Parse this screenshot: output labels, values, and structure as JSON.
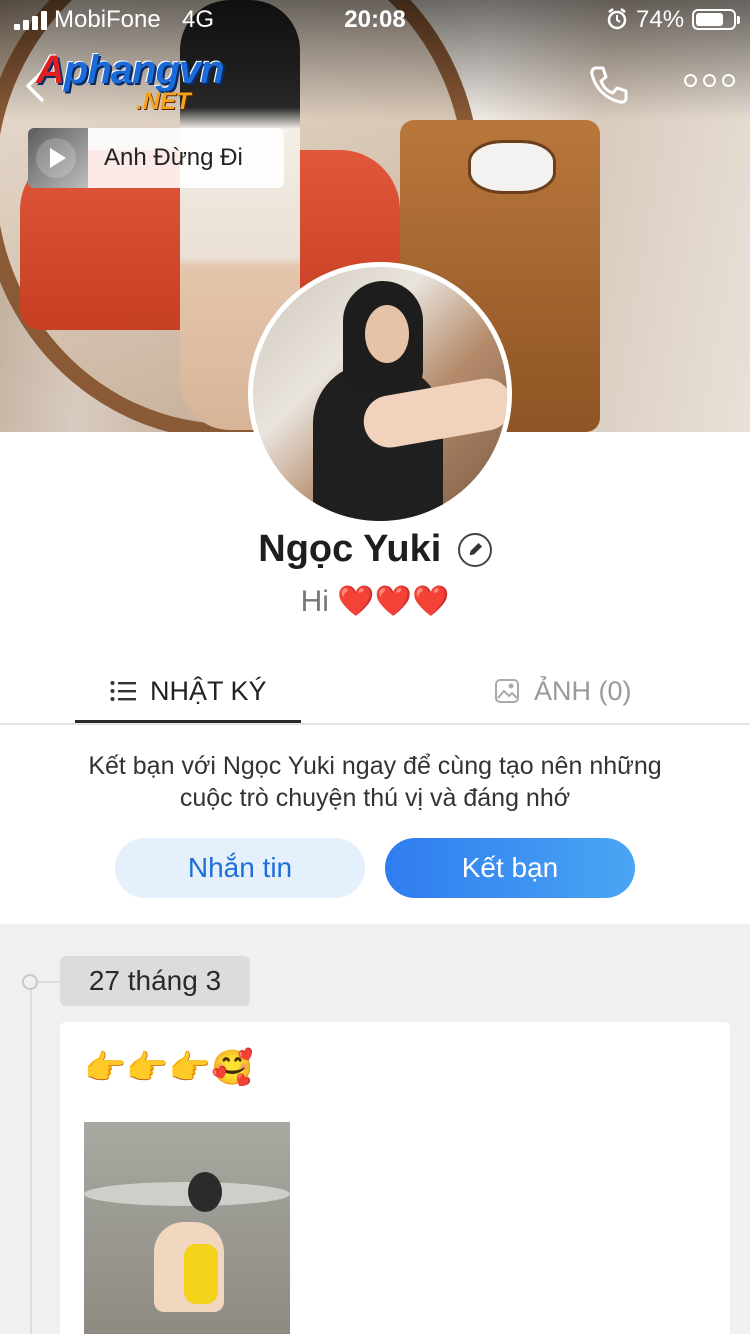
{
  "status_bar": {
    "carrier": "MobiFone",
    "network": "4G",
    "time": "20:08",
    "battery_percent": "74%",
    "battery_level": 0.74
  },
  "nav": {
    "logo_main": "Aphangvn",
    "logo_sub": ".NET",
    "back_icon": "chevron-left-icon",
    "call_icon": "phone-icon",
    "more_icon": "more-dots-icon"
  },
  "music": {
    "title": "Anh Đừng Đi",
    "icon": "play-icon"
  },
  "profile": {
    "name": "Ngọc Yuki",
    "status_text": "Hi",
    "status_emoji": "❤️❤️❤️"
  },
  "tabs": {
    "diary": "NHẬT KÝ",
    "photos": "ẢNH (0)"
  },
  "friend_prompt": {
    "line1": "Kết bạn với Ngọc Yuki ngay để cùng tạo nên những",
    "line2": "cuộc trò chuyện thú vị và đáng nhớ"
  },
  "buttons": {
    "message": "Nhắn tin",
    "add_friend": "Kết bạn"
  },
  "timeline": {
    "date": "27 tháng 3",
    "post_text": "👉👉👉🥰"
  },
  "colors": {
    "accent": "#2f7cf0",
    "message_bg": "#e5f0fd",
    "heart": "#d2202b"
  }
}
